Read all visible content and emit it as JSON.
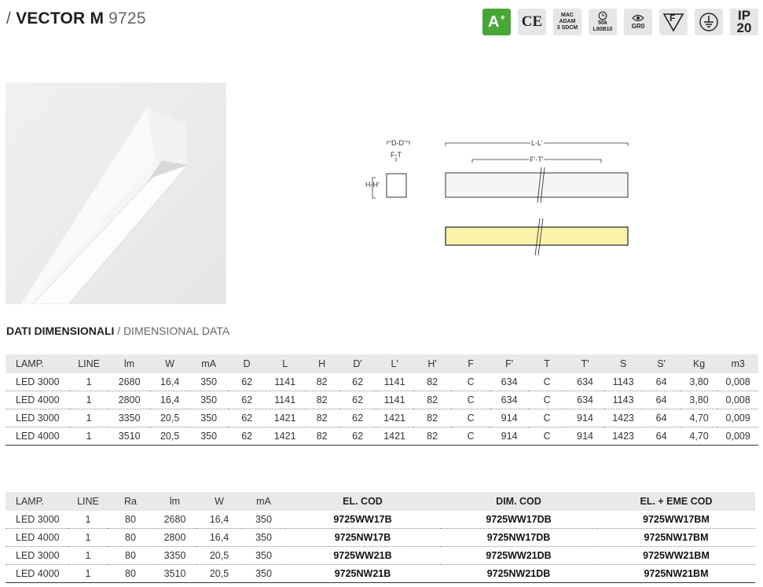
{
  "header": {
    "slash": "/ ",
    "name": "VECTOR M",
    "code": " 9725"
  },
  "badges": {
    "aplus": {
      "main": "A",
      "sup": "+"
    },
    "ce": "CE",
    "mac": [
      "MAC",
      "ADAM",
      "3 SDCM"
    ],
    "life": [
      "50k",
      "L80B10"
    ],
    "eye": "GR0",
    "f_mark": "F",
    "ip": [
      "IP",
      "20"
    ]
  },
  "diagram": {
    "dd": "D-D'",
    "ft": "F-T",
    "hh": "H-H'",
    "ll": "L-L'",
    "ftp": "F'-T'"
  },
  "section": {
    "title": "DATI DIMENSIONALI",
    "subtitle": " / DIMENSIONAL DATA"
  },
  "colors": {
    "header_bg": "#e9e9e9",
    "badge_green": "#48a637",
    "lamp_yellow": "#fbf2a8"
  },
  "table1": {
    "headers": [
      "LAMP.",
      "LINE",
      "lm",
      "W",
      "mA",
      "D",
      "L",
      "H",
      "D'",
      "L'",
      "H'",
      "F",
      "F'",
      "T",
      "T'",
      "S",
      "S'",
      "Kg",
      "m3"
    ],
    "rows": [
      [
        "LED 3000",
        "1",
        "2680",
        "16,4",
        "350",
        "62",
        "1141",
        "82",
        "62",
        "1141",
        "82",
        "C",
        "634",
        "C",
        "634",
        "1143",
        "64",
        "3,80",
        "0,008"
      ],
      [
        "LED 4000",
        "1",
        "2800",
        "16,4",
        "350",
        "62",
        "1141",
        "82",
        "62",
        "1141",
        "82",
        "C",
        "634",
        "C",
        "634",
        "1143",
        "64",
        "3,80",
        "0,008"
      ],
      [
        "LED 3000",
        "1",
        "3350",
        "20,5",
        "350",
        "62",
        "1421",
        "82",
        "62",
        "1421",
        "82",
        "C",
        "914",
        "C",
        "914",
        "1423",
        "64",
        "4,70",
        "0,009"
      ],
      [
        "LED 4000",
        "1",
        "3510",
        "20,5",
        "350",
        "62",
        "1421",
        "82",
        "62",
        "1421",
        "82",
        "C",
        "914",
        "C",
        "914",
        "1423",
        "64",
        "4,70",
        "0,009"
      ]
    ]
  },
  "table2": {
    "headers": [
      "LAMP.",
      "LINE",
      "Ra",
      "lm",
      "W",
      "mA",
      "EL. COD",
      "DIM. COD",
      "EL. + EME COD"
    ],
    "rows": [
      [
        "LED 3000",
        "1",
        "80",
        "2680",
        "16,4",
        "350",
        "9725WW17B",
        "9725WW17DB",
        "9725WW17BM"
      ],
      [
        "LED 4000",
        "1",
        "80",
        "2800",
        "16,4",
        "350",
        "9725NW17B",
        "9725NW17DB",
        "9725NW17BM"
      ],
      [
        "LED 3000",
        "1",
        "80",
        "3350",
        "20,5",
        "350",
        "9725WW21B",
        "9725WW21DB",
        "9725WW21BM"
      ],
      [
        "LED 4000",
        "1",
        "80",
        "3510",
        "20,5",
        "350",
        "9725NW21B",
        "9725NW21DB",
        "9725NW21BM"
      ]
    ]
  }
}
